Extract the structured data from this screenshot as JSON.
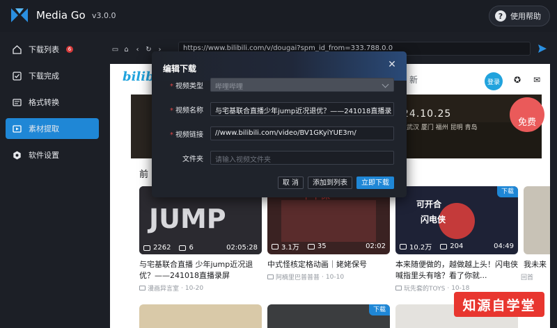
{
  "app": {
    "title": "Media Go",
    "version": "v3.0.0",
    "help_label": "使用帮助"
  },
  "sidebar": {
    "items": [
      {
        "label": "下载列表",
        "icon": "download-list-icon",
        "badge": "6"
      },
      {
        "label": "下载完成",
        "icon": "check-square-icon"
      },
      {
        "label": "格式转换",
        "icon": "convert-icon"
      },
      {
        "label": "素材提取",
        "icon": "extract-icon",
        "active": true
      },
      {
        "label": "软件设置",
        "icon": "gear-icon"
      }
    ]
  },
  "browser": {
    "url": "https://www.bilibili.com/v/dougai?spm_id_from=333.788.0.0"
  },
  "page": {
    "logo_text": "bilibili",
    "search_tail": "新",
    "login_label": "登录",
    "banner_date": "24.10.25",
    "banner_cities": "武汉 厦门 福州 昆明 青岛",
    "banner_badge": "免费",
    "section_label": "前",
    "download_tag": "下载",
    "cards": [
      {
        "views": "2262",
        "danmaku": "6",
        "duration": "02:05:28",
        "title": "与宅基联合直播 少年jump近况退优？——241018直播录屏",
        "uploader": "漫画异言室",
        "date": "10-20",
        "thumb_color": "#2b2a30",
        "tagged": false
      },
      {
        "views": "3.1万",
        "danmaku": "35",
        "duration": "02:02",
        "title": "中式怪核定格动画｜姥姥保号",
        "uploader": "阿楠里巴普普普",
        "date": "10-10",
        "thumb_color": "#3a2222",
        "tagged": false
      },
      {
        "views": "10.2万",
        "danmaku": "204",
        "duration": "04:49",
        "title": "本来随便做的，越做越上头！闪电侠喊指里头有啥？看了你就...",
        "uploader": "玩先套的TOYS",
        "date": "10-18",
        "thumb_color": "#1e2236",
        "tagged": true
      }
    ],
    "partial_title": "我未来",
    "float_label": "回首",
    "watermark": "知源自学堂"
  },
  "modal": {
    "title": "编辑下载",
    "fields": [
      {
        "label": "视频类型",
        "value": "哔哩哔哩",
        "required": true,
        "disabled": true
      },
      {
        "label": "视频名称",
        "value": "与宅基联合直播少年jump近况退优？——241018直播录",
        "required": true
      },
      {
        "label": "视频链接",
        "value": "//www.bilibili.com/video/BV1GKyiYUE3m/",
        "required": true
      },
      {
        "label": "文件夹",
        "placeholder": "请输入视频文件夹",
        "required": false
      }
    ],
    "buttons": {
      "cancel": "取 消",
      "add": "添加到列表",
      "download": "立即下载"
    }
  },
  "colors": {
    "accent": "#1f87d6",
    "required": "#e04848",
    "bili_blue": "#21a3dd"
  }
}
